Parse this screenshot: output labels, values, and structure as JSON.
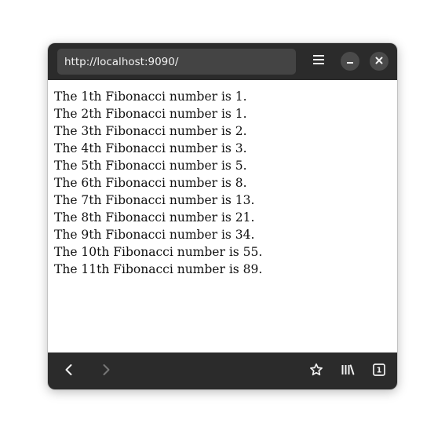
{
  "browser": {
    "url": "http://localhost:9090/"
  },
  "page": {
    "lines": [
      "The 1th Fibonacci number is 1.",
      "The 2th Fibonacci number is 1.",
      "The 3th Fibonacci number is 2.",
      "The 4th Fibonacci number is 3.",
      "The 5th Fibonacci number is 5.",
      "The 6th Fibonacci number is 8.",
      "The 7th Fibonacci number is 13.",
      "The 8th Fibonacci number is 21.",
      "The 9th Fibonacci number is 34.",
      "The 10th Fibonacci number is 55.",
      "The 11th Fibonacci number is 89."
    ]
  },
  "toolbar": {
    "tab_count": "1",
    "icons": {
      "menu": "hamburger-menu-icon",
      "minimize": "minimize-icon",
      "close": "close-icon",
      "back": "chevron-left-icon",
      "forward": "chevron-right-icon",
      "bookmark": "star-icon",
      "library": "library-icon",
      "tabs": "tab-counter-icon"
    }
  },
  "colors": {
    "chrome_bg": "#2b2b2b",
    "url_bar_bg": "#444444",
    "button_bg": "#4a4a4a",
    "icon": "#f2f2f2",
    "icon_disabled": "#767676",
    "page_bg": "#ffffff",
    "text": "#111111"
  }
}
